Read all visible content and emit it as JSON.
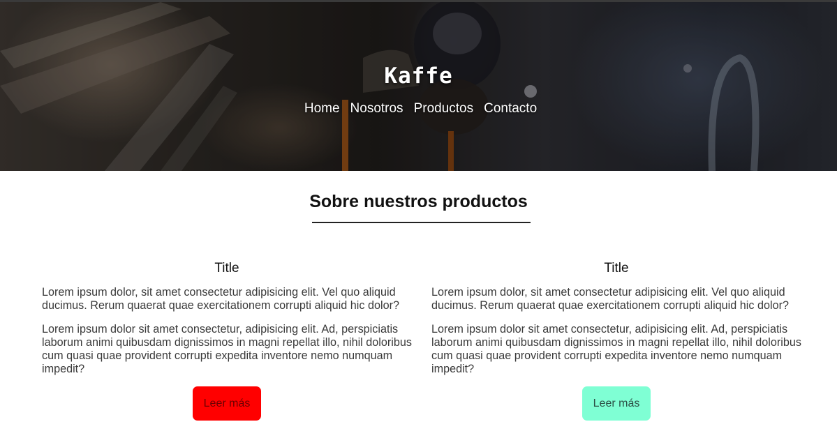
{
  "brand": {
    "name": "Kaffe"
  },
  "nav": {
    "items": [
      {
        "label": "Home"
      },
      {
        "label": "Nosotros"
      },
      {
        "label": "Productos"
      },
      {
        "label": "Contacto"
      }
    ]
  },
  "section": {
    "title": "Sobre nuestros productos"
  },
  "cards": [
    {
      "title": "Title",
      "paragraph1": "Lorem ipsum dolor, sit amet consectetur adipisicing elit. Vel quo aliquid ducimus. Rerum quaerat quae exercitationem corrupti aliquid hic dolor?",
      "paragraph2": "Lorem ipsum dolor sit amet consectetur, adipisicing elit. Ad, perspiciatis laborum animi quibusdam dignissimos in magni repellat illo, nihil doloribus cum quasi quae provident corrupti expedita inventore nemo numquam impedit?",
      "button_label": "Leer más",
      "button_color": "#ff0000"
    },
    {
      "title": "Title",
      "paragraph1": "Lorem ipsum dolor, sit amet consectetur adipisicing elit. Vel quo aliquid ducimus. Rerum quaerat quae exercitationem corrupti aliquid hic dolor?",
      "paragraph2": "Lorem ipsum dolor sit amet consectetur, adipisicing elit. Ad, perspiciatis laborum animi quibusdam dignissimos in magni repellat illo, nihil doloribus cum quasi quae provident corrupti expedita inventore nemo numquam impedit?",
      "button_label": "Leer más",
      "button_color": "#7fffd4"
    }
  ]
}
